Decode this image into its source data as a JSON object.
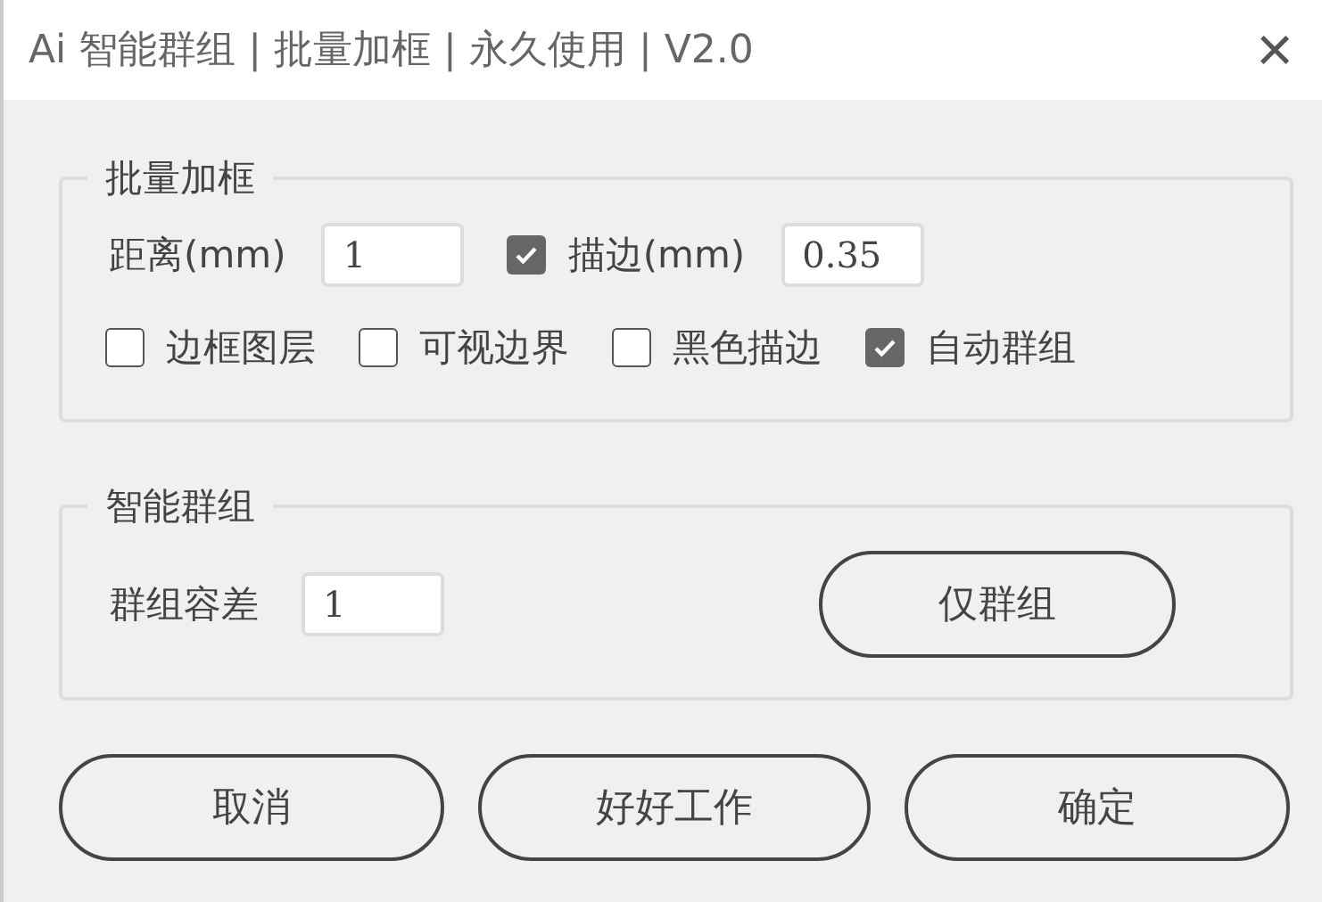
{
  "window": {
    "title": "Ai 智能群组 | 批量加框 | 永久使用 | V2.0",
    "close": "×"
  },
  "batch_frame": {
    "legend": "批量加框",
    "distance": {
      "label": "距离(mm)",
      "value": "1"
    },
    "stroke": {
      "label": "描边(mm)",
      "checked": true,
      "value": "0.35"
    },
    "options": [
      {
        "label": "边框图层",
        "checked": false
      },
      {
        "label": "可视边界",
        "checked": false
      },
      {
        "label": "黑色描边",
        "checked": false
      },
      {
        "label": "自动群组",
        "checked": true
      }
    ]
  },
  "smart_group": {
    "legend": "智能群组",
    "tolerance": {
      "label": "群组容差",
      "value": "1"
    },
    "button": "仅群组"
  },
  "buttons": [
    "取消",
    "好好工作",
    "确定"
  ]
}
